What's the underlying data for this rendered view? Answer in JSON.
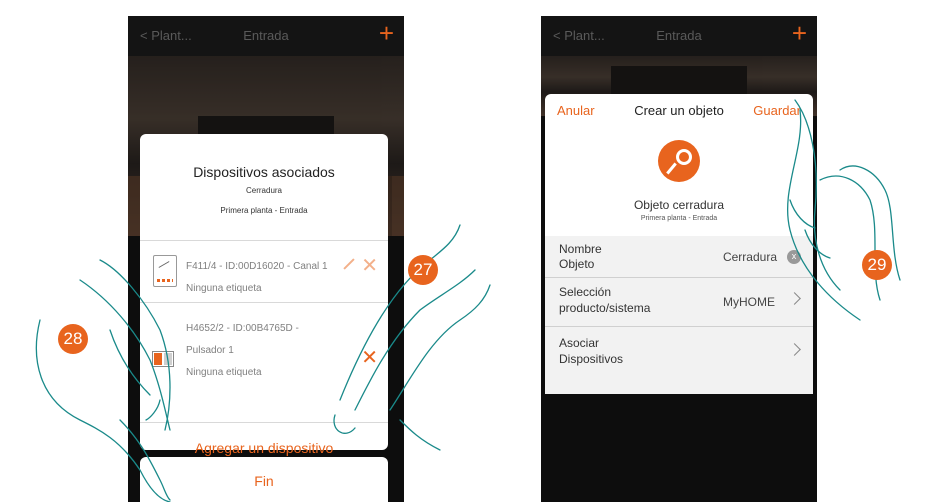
{
  "left": {
    "header": {
      "back": "Plant...",
      "title": "Entrada",
      "plus": "+"
    },
    "dialog": {
      "title": "Dispositivos asociados",
      "subtitle": "Cerradura",
      "location": "Primera planta - Entrada",
      "devices": [
        {
          "line1": "F411/4 - ID:00D16020 - Canal 1",
          "line2": "Ninguna etiqueta"
        },
        {
          "line1": "H4652/2 - ID:00B4765D -",
          "line2": "Pulsador 1",
          "line3": "Ninguna etiqueta"
        }
      ],
      "add_label": "Agregar un dispositivo"
    },
    "fin_label": "Fin",
    "badges": {
      "b28": "28",
      "b27": "27"
    }
  },
  "right": {
    "header": {
      "back": "Plant...",
      "title": "Entrada",
      "plus": "+"
    },
    "dialog": {
      "cancel": "Anular",
      "title": "Crear un objeto",
      "save": "Guardar",
      "object_name": "Objeto cerradura",
      "object_location": "Primera planta - Entrada",
      "rows": {
        "name_label_1": "Nombre",
        "name_label_2": "Objeto",
        "name_value": "Cerradura",
        "clear_glyph": "x",
        "product_label_1": "Selección",
        "product_label_2": "producto/sistema",
        "product_value": "MyHOME",
        "assoc_label_1": "Asociar",
        "assoc_label_2": "Dispositivos"
      }
    },
    "badges": {
      "b29": "29"
    }
  },
  "colors": {
    "accent": "#e8641e"
  }
}
